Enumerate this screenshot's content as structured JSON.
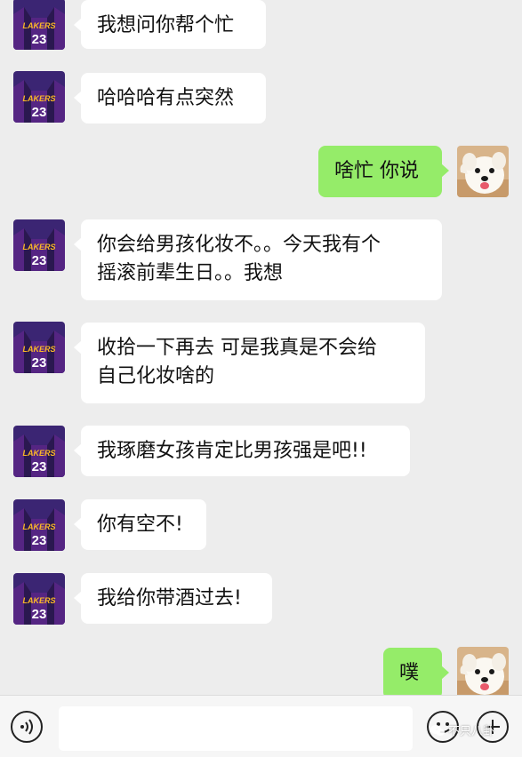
{
  "messages": [
    {
      "side": "left",
      "text": "我想问你帮个忙"
    },
    {
      "side": "left",
      "text": "哈哈哈有点突然"
    },
    {
      "side": "right",
      "text": "啥忙 你说"
    },
    {
      "side": "left",
      "text": "你会给男孩化妆不。。今天我有个\n摇滚前辈生日。。我想"
    },
    {
      "side": "left",
      "text": "收拾一下再去 可是我真是不会给\n自己化妆啥的"
    },
    {
      "side": "left",
      "text": "我琢磨女孩肯定比男孩强是吧!!"
    },
    {
      "side": "left",
      "text": "你有空不!"
    },
    {
      "side": "left",
      "text": "我给你带酒过去!"
    },
    {
      "side": "right",
      "text": "噗"
    }
  ],
  "avatars": {
    "left": {
      "icon": "lakers-23-jersey-avatar",
      "number_text": "23",
      "team_text": "LAKERS"
    },
    "right": {
      "icon": "white-dog-avatar"
    }
  },
  "input": {
    "value": "",
    "placeholder": ""
  },
  "watermark": {
    "text": "不只八卦"
  },
  "colors": {
    "background": "#ededed",
    "left_bubble": "#ffffff",
    "right_bubble": "#95ec69"
  }
}
